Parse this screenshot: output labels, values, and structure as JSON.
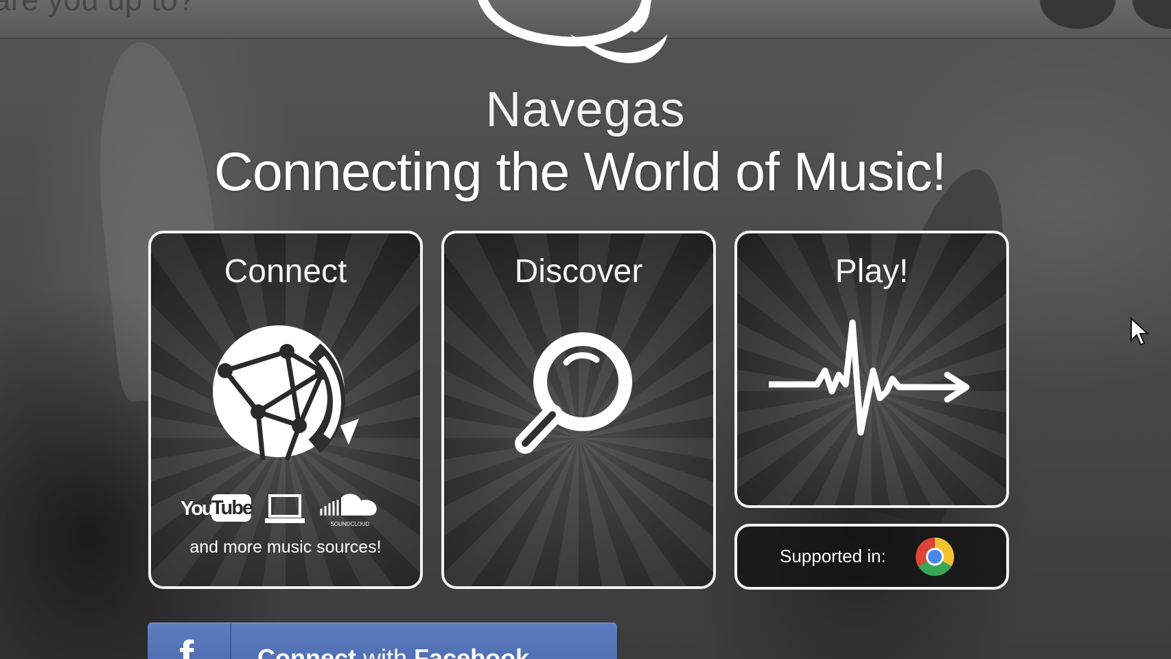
{
  "top": {
    "faded_text": "are you up to?"
  },
  "brand": {
    "name": "Navegas",
    "tagline": "Connecting the World of Music!"
  },
  "cards": {
    "connect": {
      "title": "Connect",
      "icon": "globe-network-icon",
      "sources": [
        "youtube-logo",
        "laptop-icon",
        "soundcloud-logo"
      ],
      "youtube_you": "You",
      "youtube_tube": "Tube",
      "soundcloud_label": "SOUNDCLOUD",
      "caption": "and more music sources!"
    },
    "discover": {
      "title": "Discover",
      "icon": "magnifier-icon"
    },
    "play": {
      "title": "Play!",
      "icon": "heartbeat-arrow-icon"
    },
    "supported": {
      "label": "Supported in:",
      "icon": "chrome-icon"
    }
  },
  "facebook_button": {
    "icon_letter": "f",
    "label_prefix": "Connect",
    "label_middle": " with ",
    "label_suffix": "Facebook",
    "chevron": "›"
  },
  "colors": {
    "card_border": "#f3f3f3",
    "facebook_blue": "#4a68ad",
    "background": "#4d4d4d"
  }
}
